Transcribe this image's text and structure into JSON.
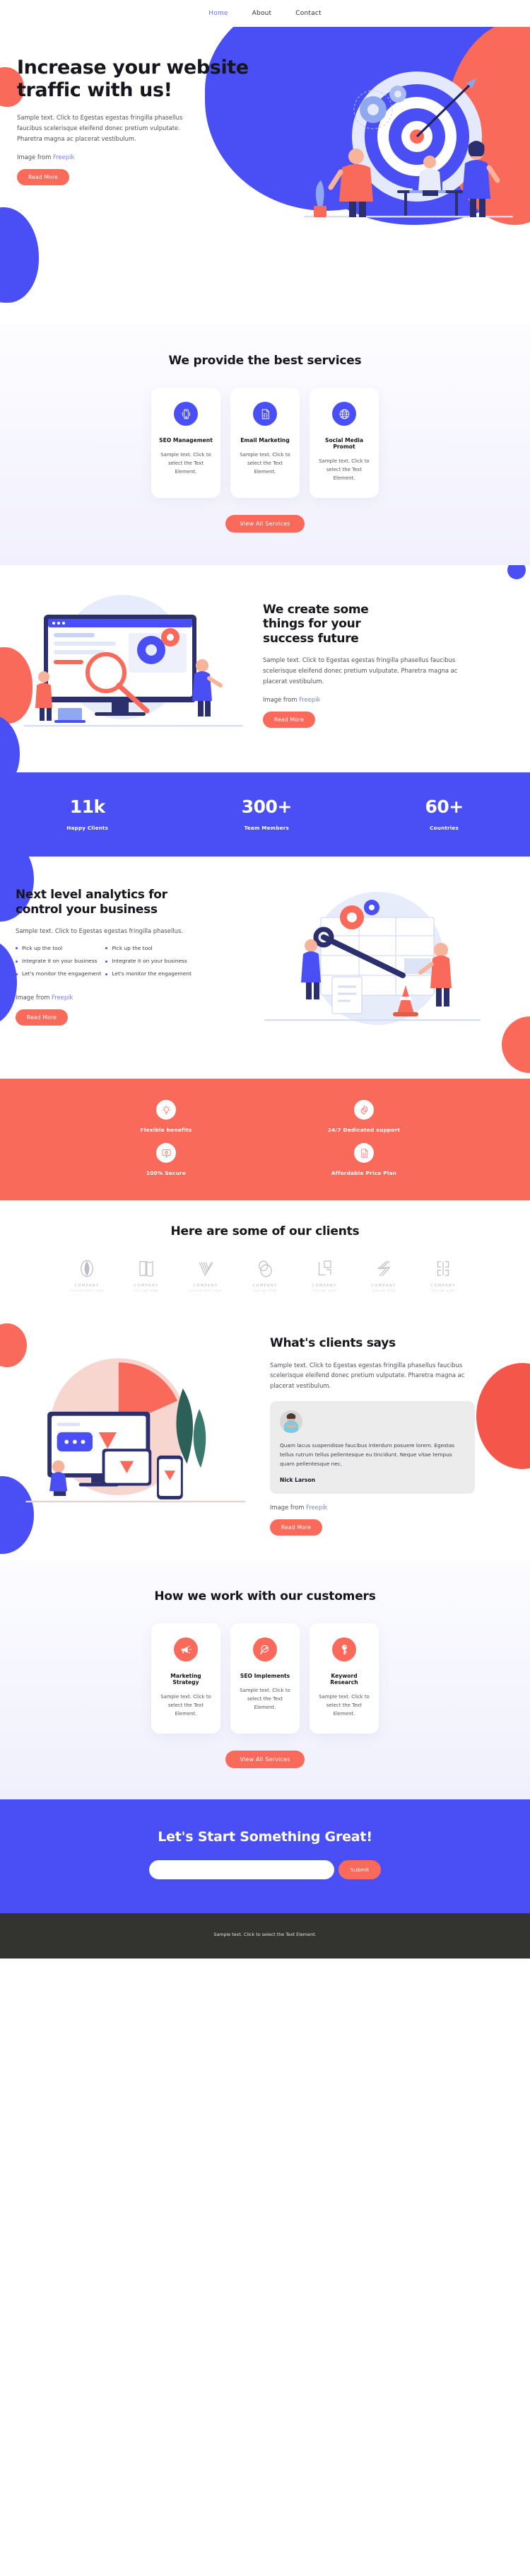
{
  "nav": {
    "items": [
      {
        "label": "Home",
        "active": true
      },
      {
        "label": "About",
        "active": false
      },
      {
        "label": "Contact",
        "active": false
      }
    ]
  },
  "hero": {
    "title": "Increase your website traffic with us!",
    "body": "Sample text. Click to Egestas egestas fringilla phasellus faucibus scelerisque eleifend donec pretium vulputate. Pharetra magna ac placerat vestibulum.",
    "credit_prefix": "Image from ",
    "credit_link": "Freepik",
    "button": "Read More"
  },
  "services": {
    "title": "We provide the best services",
    "cards": [
      {
        "icon": "mobile-signal-icon",
        "title": "SEO Management",
        "body": "Sample text. Click to select the Text Element."
      },
      {
        "icon": "document-checklist-icon",
        "title": "Email Marketing",
        "body": "Sample text. Click to select the Text Element."
      },
      {
        "icon": "globe-icon",
        "title": "Social Media Promot",
        "body": "Sample text. Click to select the Text Element."
      }
    ],
    "button": "View All Services"
  },
  "create": {
    "title": "We create some things for your success future",
    "body": "Sample text. Click to Egestas egestas fringilla phasellus faucibus scelerisque eleifend donec pretium vulputate. Pharetra magna ac placerat vestibulum.",
    "credit_prefix": "Image from ",
    "credit_link": "Freepik",
    "button": "Read More"
  },
  "stats": {
    "items": [
      {
        "num": "11k",
        "label": "Happy Clients"
      },
      {
        "num": "300+",
        "label": "Team Members"
      },
      {
        "num": "60+",
        "label": "Countries"
      }
    ]
  },
  "analytics": {
    "title": "Next level analytics for control your business",
    "body": "Sample text. Click to Egestas egestas fringilla phasellus.",
    "bullets_left": [
      "Pick up the tool",
      "Integrate it on your business",
      "Let's monitor the engagement"
    ],
    "bullets_right": [
      "Pick up the tool",
      "Integrate it on your business",
      "Let's monitor the engagement"
    ],
    "credit_prefix": "Image from ",
    "credit_link": "Freepik",
    "button": "Read More"
  },
  "features": {
    "items": [
      {
        "icon": "lightbulb-icon",
        "label": "Flexible benefits"
      },
      {
        "icon": "gear-icon",
        "label": "24/7 Dedicated support"
      },
      {
        "icon": "monitor-lock-icon",
        "label": "100% Secure"
      },
      {
        "icon": "price-document-icon",
        "label": "Affordable Price Plan"
      }
    ]
  },
  "clients": {
    "title": "Here are some of our clients",
    "logos": [
      {
        "name": "COMPANY",
        "tagline": "TAGLINE GOES HERE",
        "mark": "ring-mark-icon"
      },
      {
        "name": "COMPANY",
        "tagline": "TAG LINE HERE",
        "mark": "book-mark-icon"
      },
      {
        "name": "COMPANY",
        "tagline": "TAGLINE GOES HERE",
        "mark": "chevron-lines-mark-icon"
      },
      {
        "name": "COMPANY",
        "tagline": "TAGLINE HERE",
        "mark": "overlap-circles-mark-icon"
      },
      {
        "name": "COMPANY",
        "tagline": "TAGLINE HERE",
        "mark": "squares-mark-icon"
      },
      {
        "name": "COMPANY",
        "tagline": "TAGLINE HERE",
        "mark": "slash-lines-mark-icon"
      },
      {
        "name": "COMPANY",
        "tagline": "TAGLINE HERE",
        "mark": "bracket-mark-icon"
      }
    ]
  },
  "testimonial": {
    "title": "What's clients says",
    "body": "Sample text. Click to Egestas egestas fringilla phasellus faucibus scelerisque eleifend donec pretium vulputate. Pharetra magna ac placerat vestibulum.",
    "quote": "Quam lacus suspendisse faucibus interdum posuere lorem. Egestas tellus rutrum tellus pellentesque eu tincidunt. Neque vitae tempus quam pellentesque nec.",
    "author": "Nick Larson",
    "credit_prefix": "Image from ",
    "credit_link": "Freepik",
    "button": "Read More"
  },
  "howwork": {
    "title": "How we work with our customers",
    "cards": [
      {
        "icon": "megaphone-icon",
        "title": "Marketing Strategy",
        "body": "Sample text. Click to select the Text Element."
      },
      {
        "icon": "magnifier-chart-icon",
        "title": "SEO Implements",
        "body": "Sample text. Click to select the Text Element."
      },
      {
        "icon": "key-icon",
        "title": "Keyword Research",
        "body": "Sample text. Click to select the Text Element."
      }
    ],
    "button": "View All Services"
  },
  "cta": {
    "title": "Let's Start Something Great!",
    "input_value": "",
    "input_placeholder": "",
    "submit": "Submit"
  },
  "footer": {
    "text": "Sample text. Click to select the Text Element."
  },
  "colors": {
    "blue": "#4a4ff5",
    "coral": "#fa6a5a",
    "dark": "#16161c",
    "footer_bg": "#333330"
  }
}
